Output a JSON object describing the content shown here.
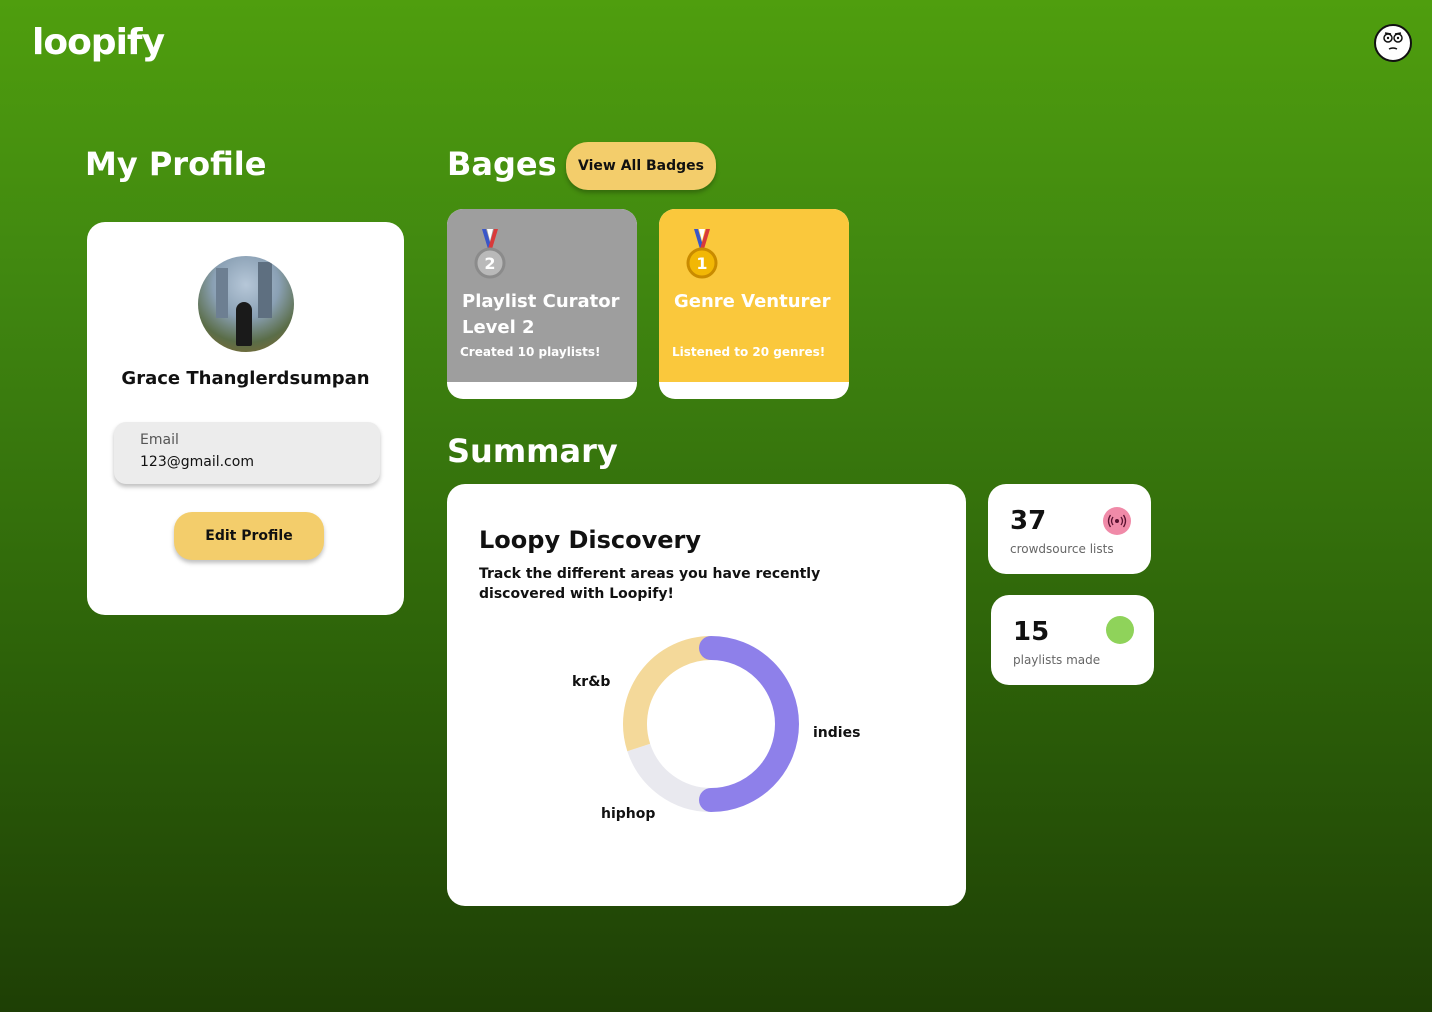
{
  "app": {
    "logo": "loopify"
  },
  "profile": {
    "section_title": "My Profile",
    "name": "Grace Thanglerdsumpan",
    "email_label": "Email",
    "email_value": "123@gmail.com",
    "edit_label": "Edit Profile"
  },
  "badges": {
    "section_title": "Bages",
    "view_all_label": "View All Badges",
    "items": [
      {
        "title": "Playlist Curator Level 2",
        "desc": "Created 10 playlists!",
        "medal": "silver-medal-icon",
        "color": "#9e9e9e",
        "rank": "2"
      },
      {
        "title": "Genre Venturer",
        "desc": "Listened to 20 genres!",
        "medal": "gold-medal-icon",
        "color": "#fac83c",
        "rank": "1"
      }
    ]
  },
  "summary": {
    "section_title": "Summary",
    "card_title": "Loopy Discovery",
    "card_desc": "Track the different areas you have recently discovered with Loopify!"
  },
  "chart_data": {
    "type": "pie",
    "donut": true,
    "categories": [
      "indies",
      "hiphop",
      "kr&b"
    ],
    "values": [
      50,
      20,
      30
    ],
    "colors": [
      "#8e80ea",
      "#e9e9ef",
      "#f4d99a"
    ]
  },
  "stats": [
    {
      "value": "37",
      "label": "crowdsource lists",
      "icon": "broadcast-icon",
      "color": "#f08aa8"
    },
    {
      "value": "15",
      "label": "playlists made",
      "icon": "green-dot-icon",
      "color": "#8fd35a"
    }
  ]
}
